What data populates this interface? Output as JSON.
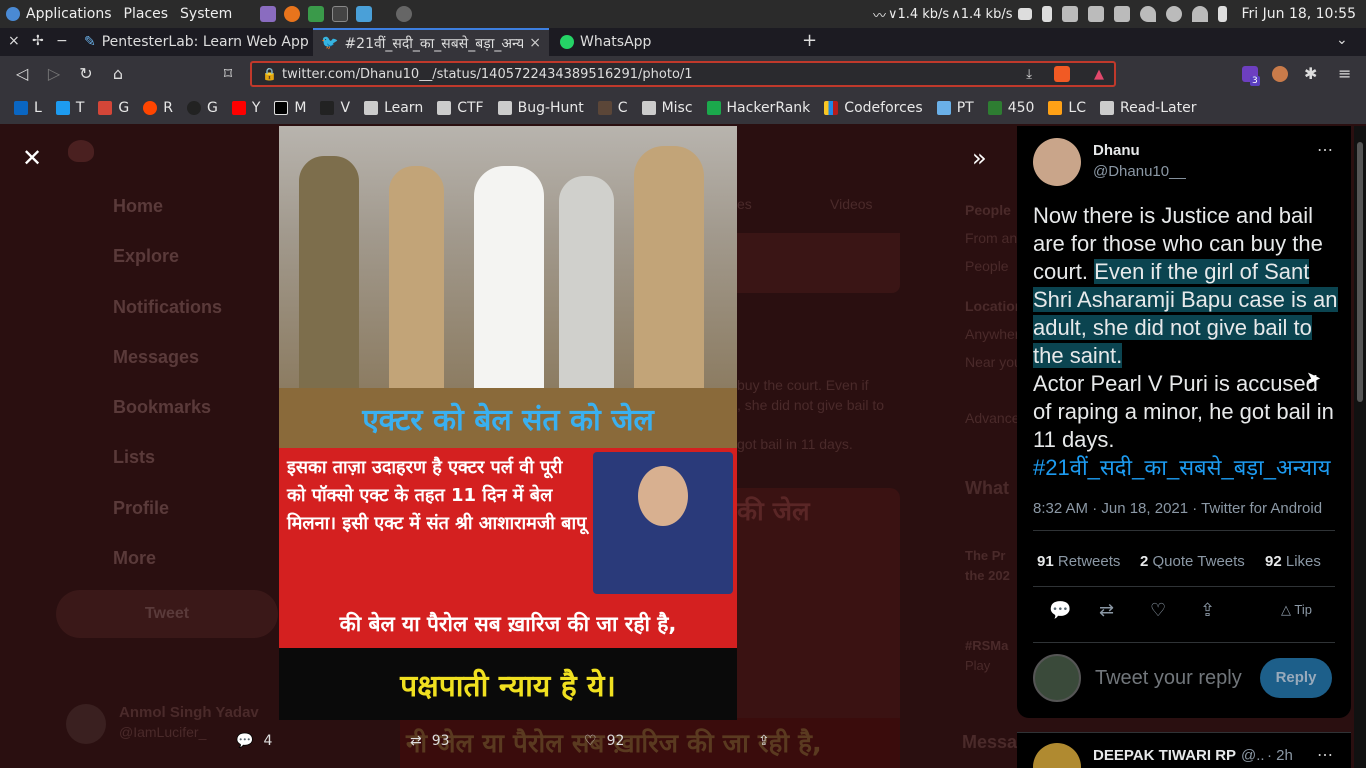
{
  "system_bar": {
    "menus": [
      "Applications",
      "Places",
      "System"
    ],
    "net_down": "1.4 kb/s",
    "net_up": "1.4 kb/s",
    "clock": "Fri Jun 18, 10:55"
  },
  "tabs": [
    {
      "label": "PentesterLab: Learn Web App"
    },
    {
      "label": "#21वीं_सदी_का_सबसे_बड़ा_अन्य"
    },
    {
      "label": "WhatsApp"
    }
  ],
  "toolbar": {
    "url": "twitter.com/Dhanu10__/status/1405722434389516291/photo/1",
    "ext_badge": "3"
  },
  "bookmarks": [
    "L",
    "T",
    "G",
    "R",
    "G",
    "Y",
    "M",
    "V",
    "Learn",
    "CTF",
    "Bug-Hunt",
    "C",
    "Misc",
    "HackerRank",
    "Codeforces",
    "PT",
    "450",
    "LC",
    "Read-Later"
  ],
  "background_nav": [
    "Home",
    "Explore",
    "Notifications",
    "Messages",
    "Bookmarks",
    "Lists",
    "Profile",
    "More"
  ],
  "background_tweet_button": "Tweet",
  "background_user": {
    "name": "Anmol Singh Yadav",
    "handle": "@IamLucifer_"
  },
  "background_right": {
    "people_heading": "People",
    "from_anyone": "From anyone",
    "people_follow": "People",
    "location_heading": "Location",
    "anywhere": "Anywhere",
    "near_you": "Near you",
    "advanced": "Advanced",
    "what": "What",
    "messages": "Messages"
  },
  "background_tweet_fragments": [
    "buy the court. Even if",
    ", she did not give bail to",
    "got bail in 11 days."
  ],
  "background_tabs": [
    "es",
    "Videos"
  ],
  "background_trends": [
    {
      "title": "The Pr",
      "sub": "the 202"
    },
    {
      "title": "#RSMa",
      "sub": "Play"
    }
  ],
  "photo": {
    "headline": "एक्टर को बेल संत को जेल",
    "body": "इसका ताज़ा उदाहरण है एक्टर पर्ल वी पूरी को पॉक्सो एक्ट के तहत 11 दिन में बेल मिलना। इसी एक्ट में संत श्री आशारामजी बापू",
    "footer1": "की बेल या पैरोल सब ख़ारिज की जा रही है,",
    "footer2": "पक्षपाती न्याय है ये।",
    "bg_tagline": "की जेल",
    "bg_footer": "नी जेल या पैरोल सब ख़ारिज की जा रही है,"
  },
  "tweet": {
    "author": "Dhanu",
    "handle": "@Dhanu10__",
    "text_part1": "Now there is Justice and bail are for those who can buy the court.",
    "text_highlight": "Even if the girl of Sant Shri Asharamji Bapu case is an adult, she did not give bail to the saint.",
    "text_part2": "Actor Pearl V Puri is accused of raping a minor, he got bail in 11 days.",
    "hashtag": "#21वीं_सदी_का_सबसे_बड़ा_अन्याय",
    "meta": "8:32 AM · Jun 18, 2021 · Twitter for Android",
    "retweets": "91",
    "retweets_label": "Retweets",
    "quotes": "2",
    "quotes_label": "Quote Tweets",
    "likes": "92",
    "likes_label": "Likes",
    "tip": "Tip",
    "reply_placeholder": "Tweet your reply",
    "reply_button": "Reply"
  },
  "next_reply": {
    "name": "DEEPAK TIWARI RP",
    "handle": "@..",
    "time": "· 2h"
  },
  "bottom_actions": {
    "replies": "4",
    "retweets": "93",
    "likes": "92"
  }
}
